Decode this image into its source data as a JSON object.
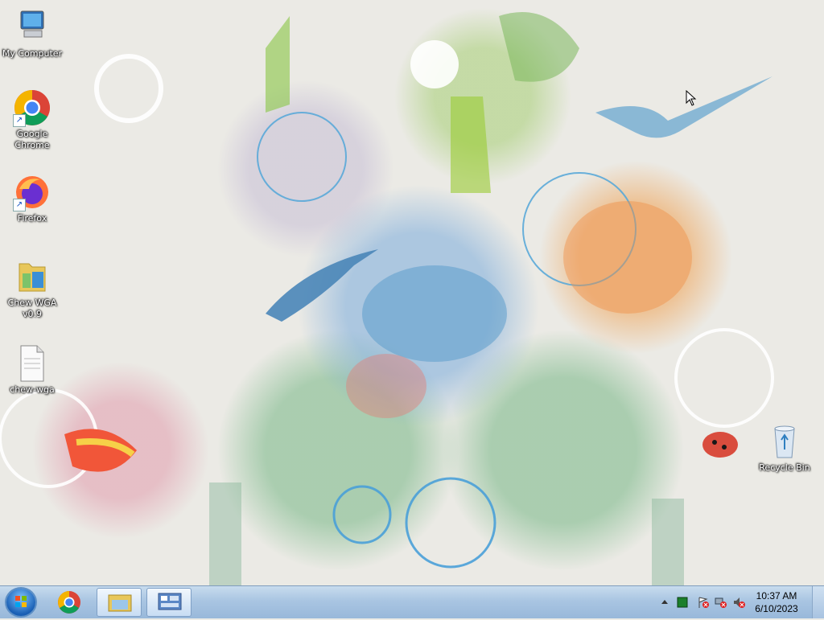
{
  "desktop": {
    "icons": [
      {
        "label": "My Computer",
        "icon": "computer-icon"
      },
      {
        "label": "Google\nChrome",
        "icon": "chrome-icon"
      },
      {
        "label": "Firefox",
        "icon": "firefox-icon"
      },
      {
        "label": "Chew WGA\nv0.9",
        "icon": "folder-icon"
      },
      {
        "label": "chew-wga",
        "icon": "file-icon"
      },
      {
        "label": "Recycle Bin",
        "icon": "recycle-bin-icon"
      }
    ]
  },
  "taskbar": {
    "pinned": [
      {
        "icon": "start-orb-icon"
      },
      {
        "icon": "chrome-icon"
      },
      {
        "icon": "explorer-icon"
      },
      {
        "icon": "control-panel-icon"
      }
    ],
    "clock": {
      "time": "10:37 AM",
      "date": "6/10/2023"
    }
  },
  "colors": {
    "taskbar": "#a9c5e2",
    "desktop": "#ebeae5"
  }
}
